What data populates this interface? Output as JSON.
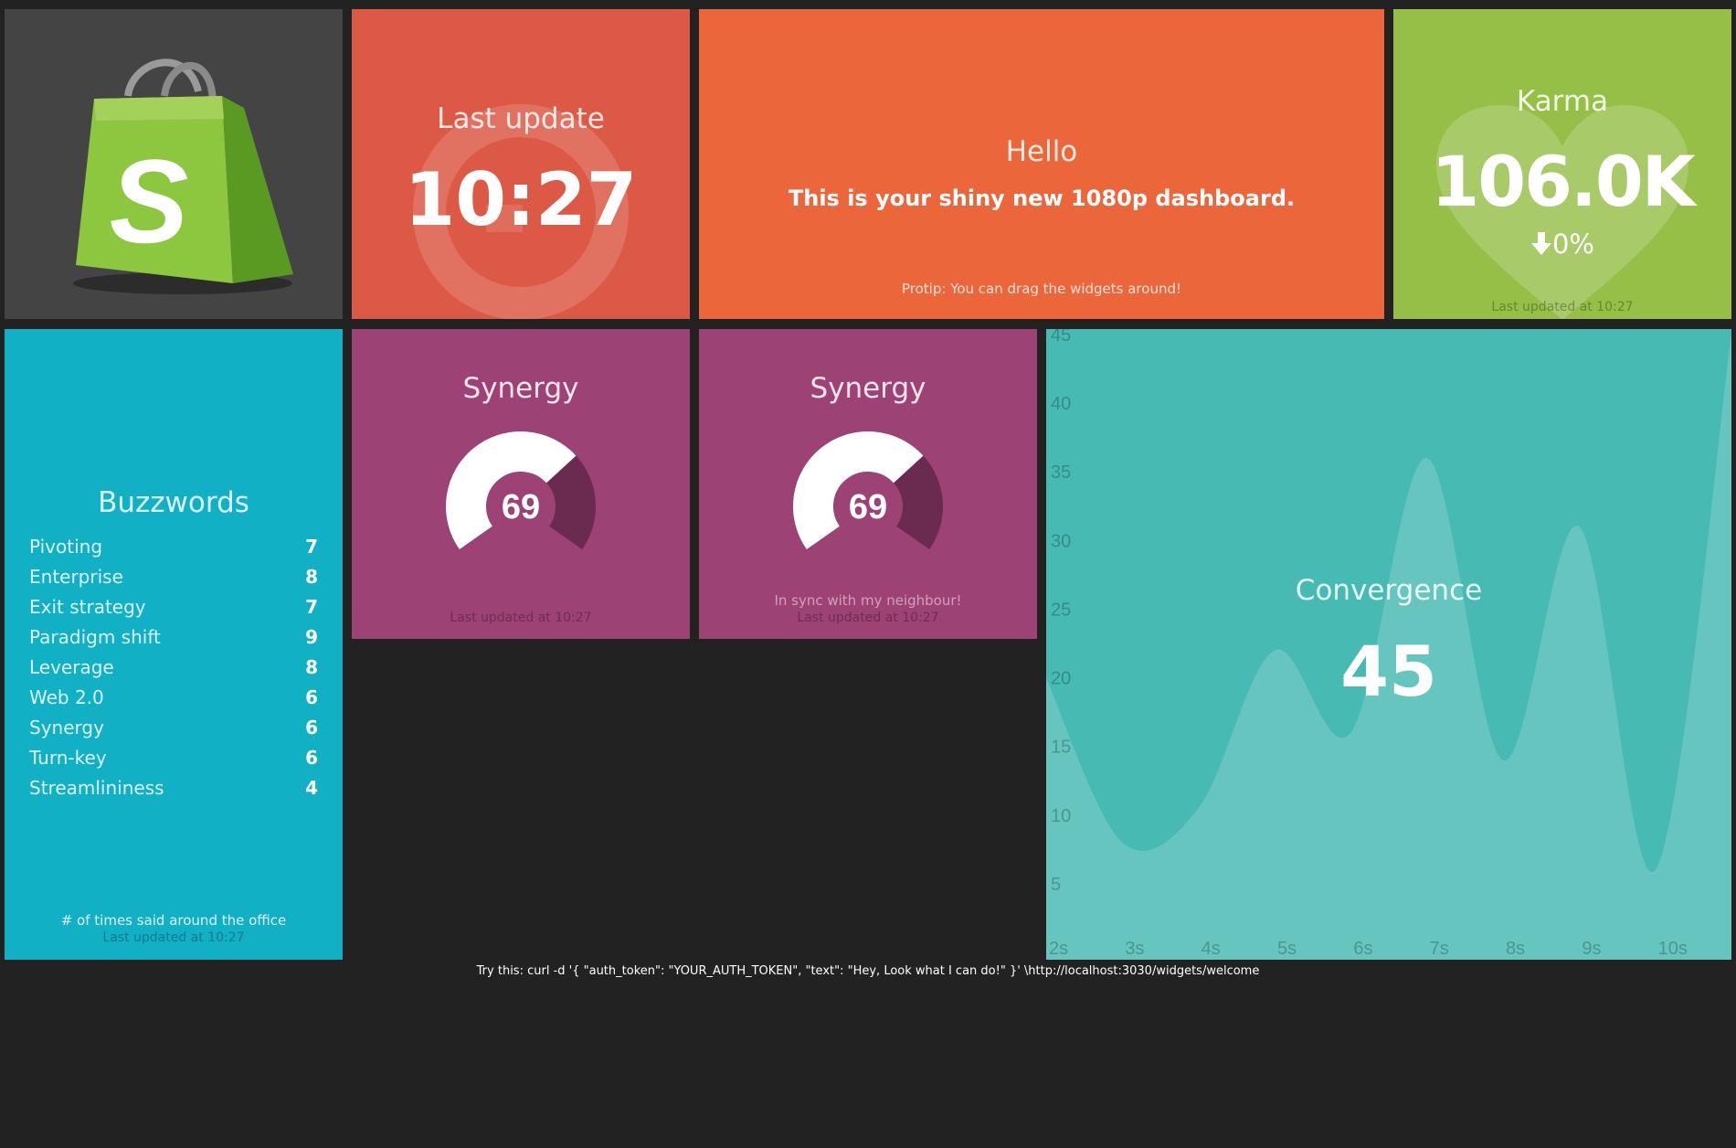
{
  "logo": {
    "name": "shopify-bag-logo",
    "letter": "S"
  },
  "clock": {
    "title": "Last update",
    "time": "10:27"
  },
  "hello": {
    "title": "Hello",
    "message": "This is your shiny new 1080p dashboard.",
    "tip": "Protip: You can drag the widgets around!"
  },
  "karma": {
    "title": "Karma",
    "value": "106.0K",
    "change": "0%",
    "change_icon": "arrow-down-icon",
    "updated": "Last updated at 10:27"
  },
  "buzzwords": {
    "title": "Buzzwords",
    "items": [
      {
        "label": "Pivoting",
        "value": "7"
      },
      {
        "label": "Enterprise",
        "value": "8"
      },
      {
        "label": "Exit strategy",
        "value": "7"
      },
      {
        "label": "Paradigm shift",
        "value": "9"
      },
      {
        "label": "Leverage",
        "value": "8"
      },
      {
        "label": "Web 2.0",
        "value": "6"
      },
      {
        "label": "Synergy",
        "value": "6"
      },
      {
        "label": "Turn-key",
        "value": "6"
      },
      {
        "label": "Streamlininess",
        "value": "4"
      }
    ],
    "more": "# of times said around the office",
    "updated": "Last updated at 10:27"
  },
  "synergy_1": {
    "title": "Synergy",
    "value": 69,
    "max": 100,
    "updated": "Last updated at 10:27"
  },
  "synergy_2": {
    "title": "Synergy",
    "value": 69,
    "max": 100,
    "more": "In sync with my neighbour!",
    "updated": "Last updated at 10:27"
  },
  "convergence": {
    "title": "Convergence",
    "value": "45"
  },
  "chart_data": {
    "type": "area",
    "x": [
      2,
      3,
      4,
      5,
      6,
      7,
      8,
      9,
      10,
      11
    ],
    "y": [
      20,
      8,
      10.5,
      22,
      16,
      36,
      14,
      31,
      6,
      45
    ],
    "xticks": [
      "2s",
      "3s",
      "4s",
      "5s",
      "6s",
      "7s",
      "8s",
      "9s",
      "10s"
    ],
    "yticks": [
      "5",
      "10",
      "15",
      "20",
      "25",
      "30",
      "35",
      "40",
      "45"
    ],
    "ylim": [
      0,
      45
    ],
    "xlim": [
      2,
      11
    ],
    "grid": false,
    "fill_color": "#66c6bf",
    "background": "#47bbb3"
  },
  "footer": {
    "text": "Try this: curl -d '{ \"auth_token\": \"YOUR_AUTH_TOKEN\", \"text\": \"Hey, Look what I can do!\" }' \\http://localhost:3030/widgets/welcome"
  },
  "colors": {
    "page_bg": "#222222",
    "logo_bg": "#444444",
    "clock_bg": "#dc5945",
    "hello_bg": "#ec663c",
    "karma_bg": "#96bf48",
    "buzzwords_bg": "#12b0c5",
    "synergy_bg": "#9c4274",
    "convergence_bg": "#47bbb3"
  }
}
